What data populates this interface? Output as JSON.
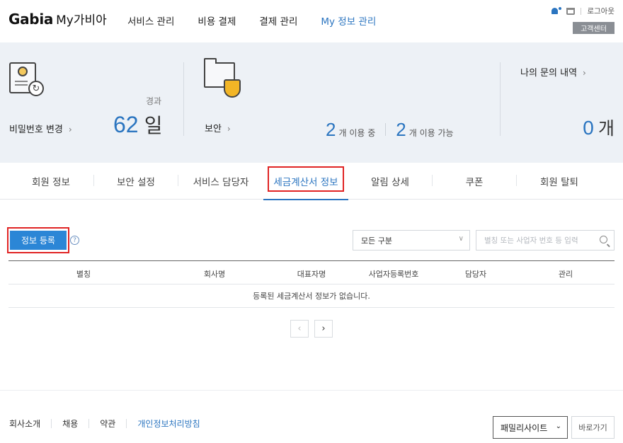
{
  "header": {
    "logo_brand": "Gabia",
    "logo_suffix": "My가비아",
    "nav": [
      "서비스 관리",
      "비용 결제",
      "결제 관리",
      "My 정보 관리"
    ],
    "logout": "로그아웃",
    "support": "고객센터"
  },
  "summary": {
    "password": {
      "label": "비밀번호 변경",
      "caption": "경과",
      "value": "62",
      "unit": "일"
    },
    "security": {
      "label": "보안",
      "in_use_count": "2",
      "in_use_text": "개 이용 중",
      "available_count": "2",
      "available_text": "개 이용 가능"
    },
    "inquiry": {
      "label": "나의 문의 내역",
      "value": "0",
      "unit": "개"
    }
  },
  "tabs": [
    "회원 정보",
    "보안 설정",
    "서비스 담당자",
    "세금계산서 정보",
    "알림 상세",
    "쿠폰",
    "회원 탈퇴"
  ],
  "content": {
    "register_button": "정보 등록",
    "help_glyph": "?",
    "category_select": "모든 구분",
    "search_placeholder": "별칭 또는 사업자 번호 등 입력",
    "columns": [
      "별칭",
      "회사명",
      "대표자명",
      "사업자등록번호",
      "담당자",
      "관리"
    ],
    "empty_message": "등록된 세금계산서 정보가 없습니다.",
    "prev": "‹",
    "next": "›"
  },
  "footer": {
    "links": [
      "회사소개",
      "채용",
      "약관",
      "개인정보처리방침"
    ],
    "family_site": "패밀리사이트",
    "go_button": "바로가기"
  },
  "colors": {
    "accent": "#2b75c0",
    "button": "#2b86d6",
    "highlight": "#e02424"
  }
}
